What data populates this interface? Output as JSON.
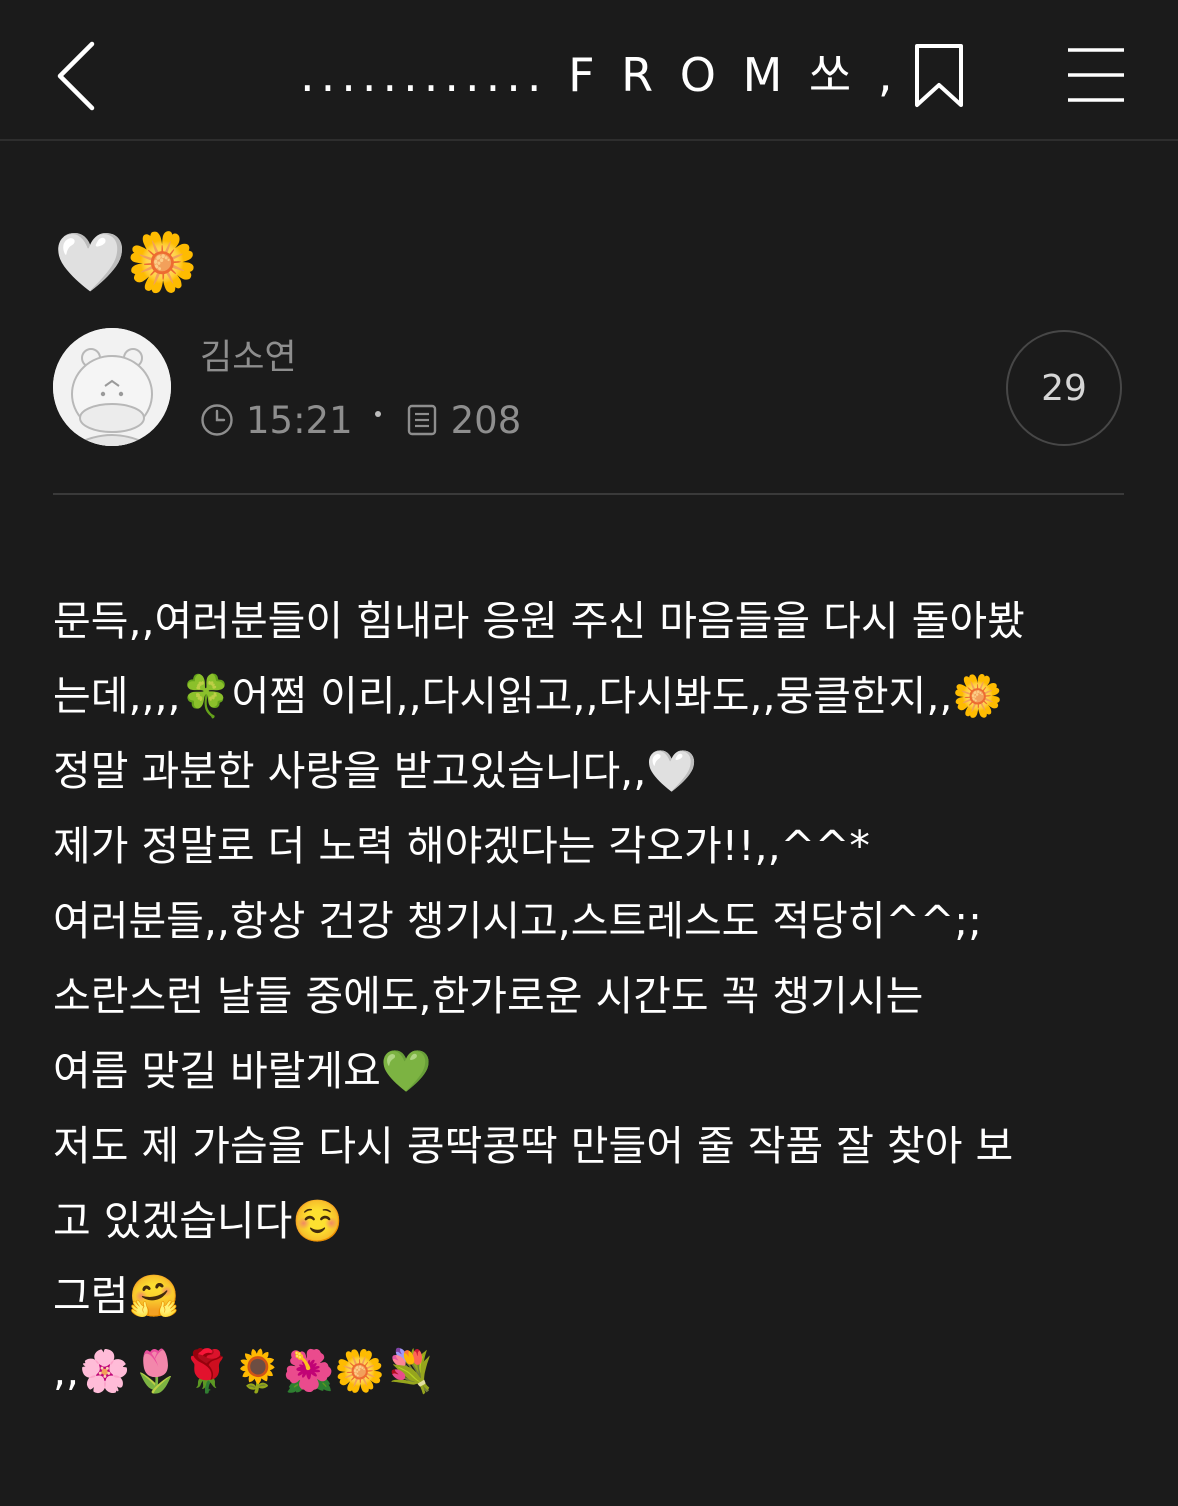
{
  "header": {
    "title": "............ F R O M 쏘 ,"
  },
  "post": {
    "title_emoji": {
      "heart": "🤍",
      "flower": "🌼"
    },
    "author": "김소연",
    "time": "15:21",
    "count": "208",
    "comments": "29",
    "lines": [
      "문득,,여러분들이 힘내라 응원 주신 마음들을 다시 돌아봤",
      "는데,,,,🍀어쩜 이리,,다시읽고,,다시봐도,,뭉클한지,,🌼",
      "정말 과분한 사랑을 받고있습니다,,🤍",
      "제가 정말로 더 노력 해야겠다는 각오가!!,,^^*",
      "여러분들,,항상 건강 챙기시고,스트레스도 적당히^^;;",
      "소란스런 날들 중에도,한가로운 시간도 꼭 챙기시는",
      "여름 맞길 바랄게요💚",
      "저도 제 가슴을 다시 콩딱콩딱 만들어 줄 작품 잘 찾아 보",
      "고 있겠습니다☺️",
      "그럼🤗",
      ",,🌸🌷🌹🌻🌺🌼💐"
    ]
  },
  "colors": {
    "background": "#1b1b1b",
    "text": "#ffffff",
    "muted": "#8e8e8e",
    "divider": "#3a3a3a"
  },
  "icons": [
    "chevron-left-icon",
    "bookmark-icon",
    "menu-icon",
    "clock-icon",
    "document-icon"
  ]
}
